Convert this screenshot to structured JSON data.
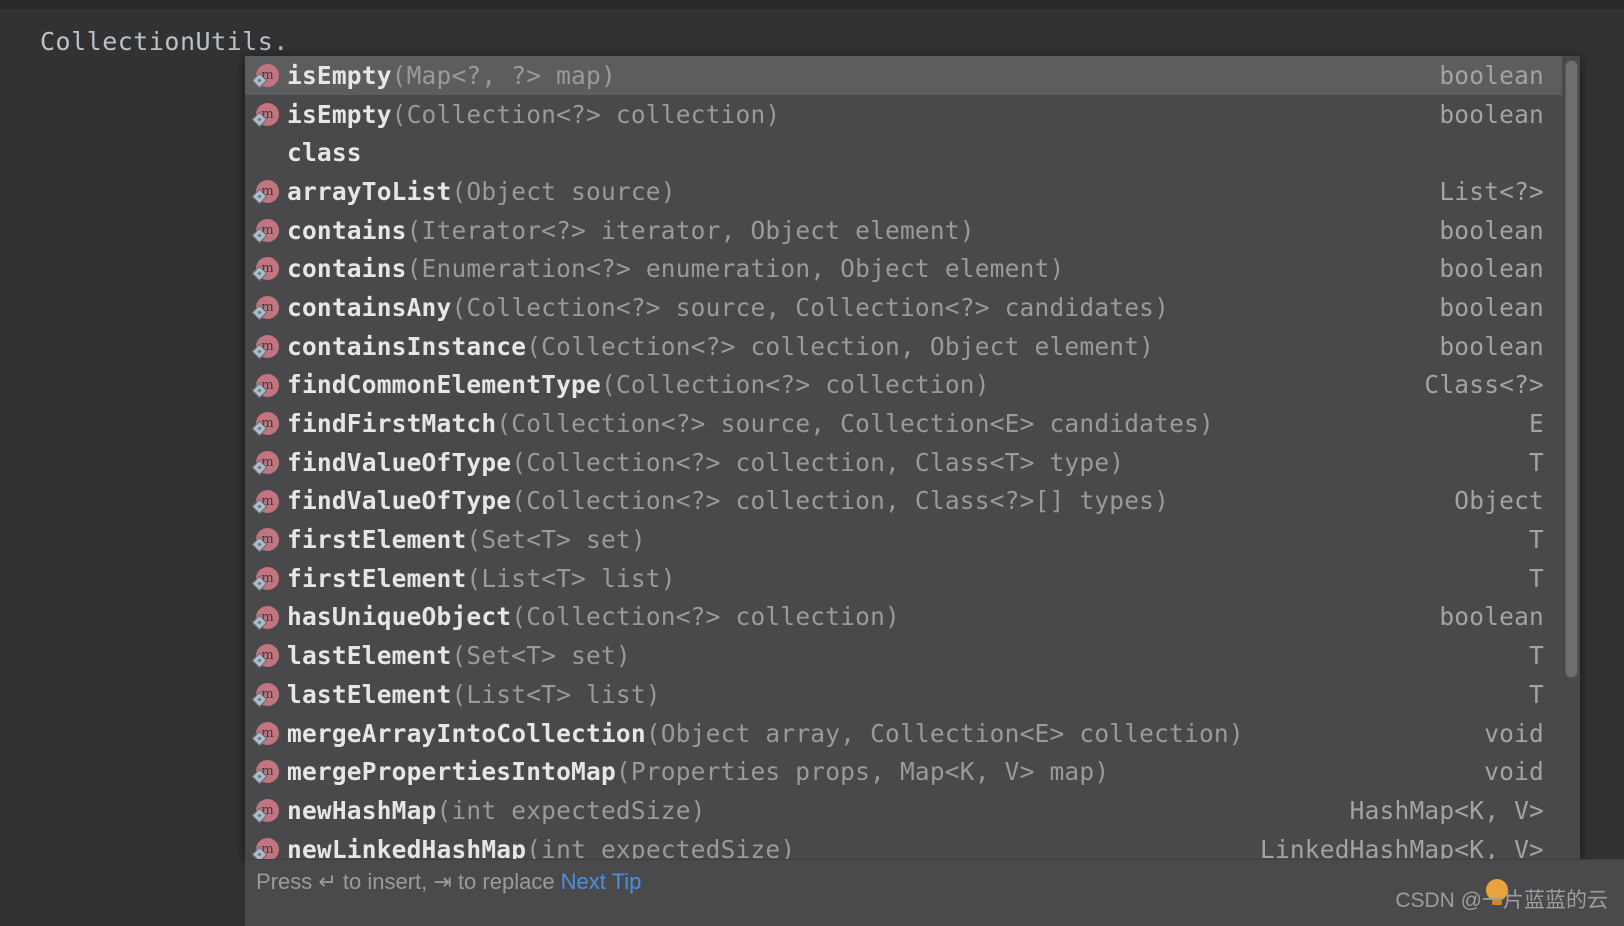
{
  "editor": {
    "line_text": "CollectionUtils.",
    "error_marker": "red-squiggle"
  },
  "completion_popup": {
    "selected_index": 0,
    "scrollbar": {
      "name": "vertical-scrollbar"
    },
    "rows": [
      {
        "icon": "method-static-icon",
        "name": "isEmpty",
        "params": "(Map<?, ?> map)",
        "rtype": "boolean",
        "selected": true
      },
      {
        "icon": "method-static-icon",
        "name": "isEmpty",
        "params": "(Collection<?> collection)",
        "rtype": "boolean",
        "selected": false
      },
      {
        "icon": "none",
        "name": "class",
        "params": "",
        "rtype": "",
        "selected": false
      },
      {
        "icon": "method-static-icon",
        "name": "arrayToList",
        "params": "(Object source)",
        "rtype": "List<?>",
        "selected": false
      },
      {
        "icon": "method-static-icon",
        "name": "contains",
        "params": "(Iterator<?> iterator, Object element)",
        "rtype": "boolean",
        "selected": false
      },
      {
        "icon": "method-static-icon",
        "name": "contains",
        "params": "(Enumeration<?> enumeration, Object element)",
        "rtype": "boolean",
        "selected": false
      },
      {
        "icon": "method-static-icon",
        "name": "containsAny",
        "params": "(Collection<?> source, Collection<?> candidates)",
        "rtype": "boolean",
        "selected": false
      },
      {
        "icon": "method-static-icon",
        "name": "containsInstance",
        "params": "(Collection<?> collection, Object element)",
        "rtype": "boolean",
        "selected": false
      },
      {
        "icon": "method-static-icon",
        "name": "findCommonElementType",
        "params": "(Collection<?> collection)",
        "rtype": "Class<?>",
        "selected": false
      },
      {
        "icon": "method-static-icon",
        "name": "findFirstMatch",
        "params": "(Collection<?> source, Collection<E> candidates)",
        "rtype": "E",
        "selected": false
      },
      {
        "icon": "method-static-icon",
        "name": "findValueOfType",
        "params": "(Collection<?> collection, Class<T> type)",
        "rtype": "T",
        "selected": false
      },
      {
        "icon": "method-static-icon",
        "name": "findValueOfType",
        "params": "(Collection<?> collection, Class<?>[] types)",
        "rtype": "Object",
        "selected": false
      },
      {
        "icon": "method-static-icon",
        "name": "firstElement",
        "params": "(Set<T> set)",
        "rtype": "T",
        "selected": false
      },
      {
        "icon": "method-static-icon",
        "name": "firstElement",
        "params": "(List<T> list)",
        "rtype": "T",
        "selected": false
      },
      {
        "icon": "method-static-icon",
        "name": "hasUniqueObject",
        "params": "(Collection<?> collection)",
        "rtype": "boolean",
        "selected": false
      },
      {
        "icon": "method-static-icon",
        "name": "lastElement",
        "params": "(Set<T> set)",
        "rtype": "T",
        "selected": false
      },
      {
        "icon": "method-static-icon",
        "name": "lastElement",
        "params": "(List<T> list)",
        "rtype": "T",
        "selected": false
      },
      {
        "icon": "method-static-icon",
        "name": "mergeArrayIntoCollection",
        "params": "(Object array, Collection<E> collection)",
        "rtype": "void",
        "selected": false
      },
      {
        "icon": "method-static-icon",
        "name": "mergePropertiesIntoMap",
        "params": "(Properties props, Map<K, V> map)",
        "rtype": "void",
        "selected": false
      },
      {
        "icon": "method-static-icon",
        "name": "newHashMap",
        "params": "(int expectedSize)",
        "rtype": "HashMap<K, V>",
        "selected": false
      },
      {
        "icon": "method-static-icon",
        "name": "newLinkedHashMap",
        "params": "(int expectedSize)",
        "rtype": "LinkedHashMap<K, V>",
        "selected": false
      }
    ]
  },
  "footer": {
    "hint_prefix": "Press ",
    "insert_key": "↵",
    "hint_middle": " to insert, ",
    "replace_key": "⇥",
    "hint_suffix": " to replace  ",
    "next_tip_label": "Next Tip"
  },
  "watermark": {
    "text": "CSDN @一片蓝蓝的云"
  },
  "colors": {
    "editor_bg": "#323232",
    "popup_bg": "#49494b",
    "selected_row": "#5b5d5f",
    "method_icon": "#c2757f",
    "link_blue": "#4a90e2",
    "method_text": "#e6e6e6",
    "param_text": "#9a9a9a",
    "rtype_text": "#a3a3a3"
  }
}
